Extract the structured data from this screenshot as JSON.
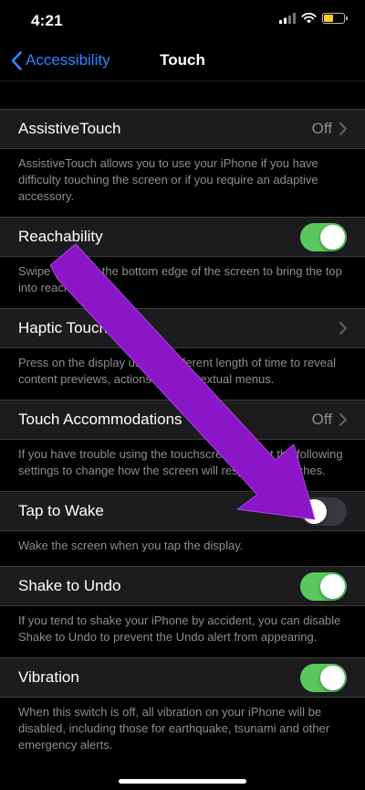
{
  "status_bar": {
    "time": "4:21"
  },
  "nav": {
    "back_label": "Accessibility",
    "title": "Touch"
  },
  "rows": [
    {
      "label": "AssistiveTouch",
      "value": "Off",
      "control": "chevron",
      "footer": "AssistiveTouch allows you to use your iPhone if you have difficulty touching the screen or if you require an adaptive accessory."
    },
    {
      "label": "Reachability",
      "value": "",
      "control": "switch-on",
      "footer": "Swipe down on the bottom edge of the screen to bring the top into reach."
    },
    {
      "label": "Haptic Touch",
      "value": "",
      "control": "chevron",
      "footer": "Press on the display using a different length of time to reveal content previews, actions and contextual menus."
    },
    {
      "label": "Touch Accommodations",
      "value": "Off",
      "control": "chevron",
      "footer": "If you have trouble using the touchscreen, adjust the following settings to change how the screen will respond to touches."
    },
    {
      "label": "Tap to Wake",
      "value": "",
      "control": "switch-off",
      "footer": "Wake the screen when you tap the display."
    },
    {
      "label": "Shake to Undo",
      "value": "",
      "control": "switch-on",
      "footer": "If you tend to shake your iPhone by accident, you can disable Shake to Undo to prevent the Undo alert from appearing."
    },
    {
      "label": "Vibration",
      "value": "",
      "control": "switch-on",
      "footer": "When this switch is off, all vibration on your iPhone will be disabled, including those for earthquake, tsunami and other emergency alerts."
    }
  ],
  "switches": {
    "reachability": true,
    "tap_to_wake": false,
    "shake_to_undo": true,
    "vibration": true
  },
  "colors": {
    "accent": "#2f86ff",
    "switch_on": "#59c75d",
    "annotation_arrow": "#8a16c7",
    "battery": "#f6cf33"
  }
}
